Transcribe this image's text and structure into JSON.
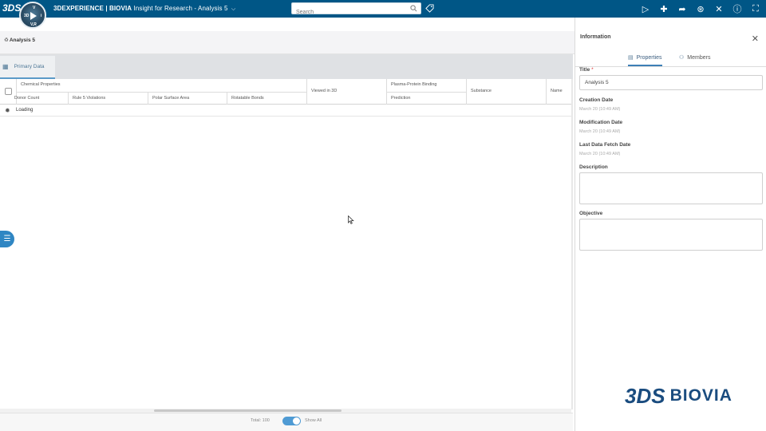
{
  "topbar": {
    "logo_text": "3DS",
    "compass_quadrants": [
      "3D",
      "V",
      "V,R",
      "i"
    ],
    "brand": "3DEXPERIENCE | BIOVIA",
    "app_name": "Insight for Research - Analysis 5",
    "search_placeholder": "Search",
    "icons": [
      "tag-icon",
      "share-icon",
      "plus-icon",
      "forward-icon",
      "network-icon",
      "tools-icon",
      "help-icon",
      "fullscreen-icon"
    ]
  },
  "analysis": {
    "title": "Analysis 5",
    "actions": [
      "forward-icon",
      "save-icon",
      "export-icon",
      "import-icon",
      "link-icon",
      "chart-icon",
      "filter-icon",
      "info-icon",
      "help-icon",
      "home-icon"
    ]
  },
  "grid": {
    "tab_label": "Primary Data",
    "group_headers": {
      "chemical_properties": "Chemical Properties",
      "viewed_in_3d": "Viewed in 3D",
      "plasma_protein_binding": "Plasma-Protein Binding",
      "substance": "Substance",
      "name": "Name"
    },
    "columns": [
      "Donor Count",
      "Rule 5 Violations",
      "Polar Surface Area",
      "Rotatable Bonds",
      "Prediction"
    ],
    "loading_text": "Loading",
    "footer_total": "Total: 100",
    "show_all_label": "Show All",
    "show_all_enabled": true
  },
  "panel": {
    "title": "Information",
    "tabs": [
      "Properties",
      "Members"
    ],
    "active_tab": "Properties",
    "fields": {
      "title_label": "Title",
      "title_required_mark": "*",
      "title_value": "Analysis 5",
      "creation_label": "Creation Date",
      "creation_value": "March 20 (10:49 AM)",
      "modification_label": "Modification Date",
      "modification_value": "March 20 (10:49 AM)",
      "fetch_label": "Last Data Fetch Date",
      "fetch_value": "March 20 (10:49 AM)",
      "description_label": "Description",
      "description_value": "",
      "objective_label": "Objective",
      "objective_value": ""
    }
  },
  "branding": {
    "mark": "3DS",
    "word": "BIOVIA"
  },
  "colors": {
    "topbar": "#005686",
    "accent": "#4f9bd4",
    "brand_text": "#1a4c7f"
  }
}
